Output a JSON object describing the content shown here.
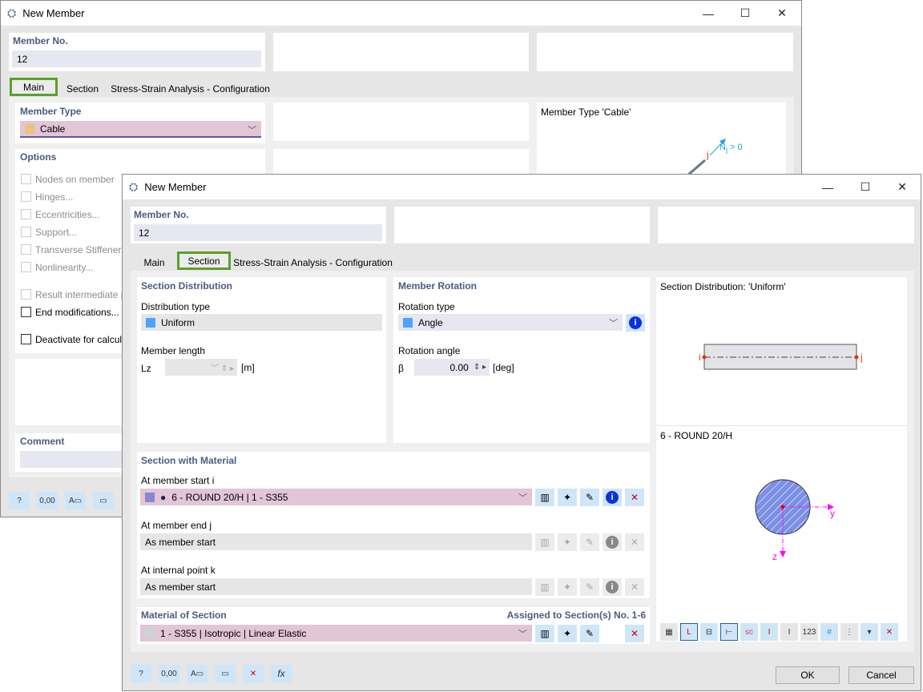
{
  "back": {
    "title": "New Member",
    "member_no_label": "Member No.",
    "member_no": "12",
    "tabs": [
      "Main",
      "Section",
      "Stress-Strain Analysis - Configuration"
    ],
    "member_type_label": "Member Type",
    "member_type": "Cable",
    "member_type_color": "#e8c383",
    "options_label": "Options",
    "options": [
      {
        "label": "Nodes on member",
        "enabled": false
      },
      {
        "label": "Hinges...",
        "enabled": false
      },
      {
        "label": "Eccentricities...",
        "enabled": false
      },
      {
        "label": "Support...",
        "enabled": false
      },
      {
        "label": "Transverse Stiffeners...",
        "enabled": false
      },
      {
        "label": "Nonlinearity...",
        "enabled": false
      },
      {
        "label": "Result intermediate p",
        "enabled": false
      },
      {
        "label": "End modifications...",
        "enabled": true
      },
      {
        "label": "Deactivate for calcula",
        "enabled": true
      }
    ],
    "comment_label": "Comment",
    "preview_title": "Member Type 'Cable'",
    "preview_node": "j",
    "preview_force": "N",
    "preview_force_sub": "j",
    "preview_force_cond": " > 0"
  },
  "front": {
    "title": "New Member",
    "member_no_label": "Member No.",
    "member_no": "12",
    "tabs": [
      "Main",
      "Section",
      "Stress-Strain Analysis - Configuration"
    ],
    "active_tab": "Section",
    "section_distribution": {
      "header": "Section Distribution",
      "dist_type_label": "Distribution type",
      "dist_type": "Uniform",
      "dist_color": "#4da3ff",
      "length_label": "Member length",
      "length_symbol": "Lz",
      "length_unit": "[m]"
    },
    "member_rotation": {
      "header": "Member Rotation",
      "rot_type_label": "Rotation type",
      "rot_type": "Angle",
      "rot_color": "#4da3ff",
      "angle_label": "Rotation angle",
      "angle_symbol": "β",
      "angle_value": "0.00",
      "angle_unit": "[deg]"
    },
    "section_material": {
      "header": "Section with Material",
      "start_label": "At member start i",
      "start_value": "6 - ROUND 20/H | 1 - S355",
      "start_color": "#8a86d6",
      "end_label": "At member end j",
      "end_value": "As member start",
      "internal_label": "At internal point k",
      "internal_value": "As member start"
    },
    "material": {
      "header": "Material of Section",
      "assigned": "Assigned to Section(s) No. 1-6",
      "value": "1 - S355 | Isotropic | Linear Elastic",
      "color": "#cfd3d6"
    },
    "preview": {
      "dist_title": "Section Distribution: 'Uniform'",
      "node_i": "i",
      "node_j": "j",
      "section_title": "6 - ROUND 20/H",
      "axis_y": "y",
      "axis_z": "z",
      "section_color": "#7b8fe6",
      "axis_color": "#ff00ff"
    },
    "ok": "OK",
    "cancel": "Cancel",
    "units_icon_text": "0,00"
  }
}
